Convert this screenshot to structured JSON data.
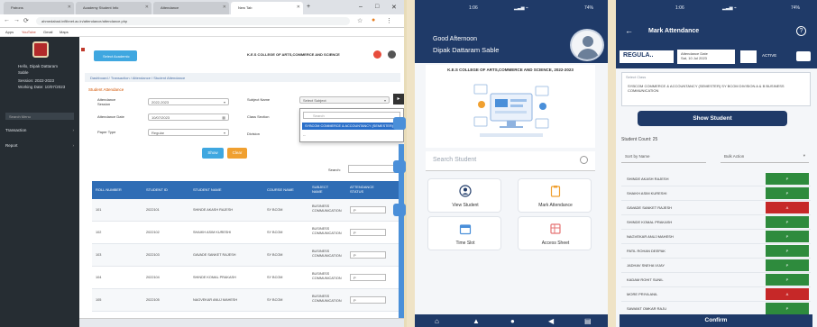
{
  "desktop": {
    "tabs": [
      {
        "label": "Patrons"
      },
      {
        "label": "Academy Student Info"
      },
      {
        "label": "Attendance"
      },
      {
        "label": "New Tab"
      }
    ],
    "url": "ahmedabad.inflibnet.ac.in/attendance/attendance.php",
    "bookmarks": [
      "Apps",
      "YouTube",
      "Gmail",
      "Maps"
    ],
    "sidebar": {
      "user_lines": [
        "Hello, Dipak Dattaram",
        "Sable",
        "Session: 2022-2023",
        "Working Date: 10/07/2023"
      ],
      "search_placeholder": "Search Menu",
      "items": [
        {
          "label": "Transaction"
        },
        {
          "label": "Report"
        }
      ]
    },
    "topbar": {
      "select_button": "Select Academic",
      "college": "K.E.S COLLEGE OF ARTS,COMMERCE AND SCIENCE"
    },
    "breadcrumb": "Dashboard / Transaction / Attendance / Student Attendance",
    "form": {
      "title": "Student Attendance",
      "fields": [
        {
          "label": "Attendance Session",
          "value": "2022-2023"
        },
        {
          "label": "Attendance Date",
          "value": "10/07/2023"
        },
        {
          "label": "Paper Type",
          "value": "Regular"
        },
        {
          "label": "Subject Name",
          "value": "Select Subject"
        },
        {
          "label": "Class Section",
          "value": ""
        },
        {
          "label": "Division",
          "value": "--"
        }
      ],
      "dropdown_search_placeholder": "Search",
      "dropdown_option": "SYBCOM COMMERCE & ACCOUNTANCY (SEMESTER)",
      "buttons": {
        "show": "Show",
        "clear": "Clear"
      },
      "search_label": "Search:"
    },
    "table": {
      "headers": [
        "ROLL NUMBER",
        "STUDENT ID",
        "STUDENT NAME",
        "COURSE NAME",
        "SUBJECT NAME",
        "ATTENDANCE STATUS"
      ],
      "rows": [
        {
          "roll": "101",
          "id": "2022101",
          "name": "SHINDE AKASH RAJESH",
          "course": "SY BCOM",
          "subject": "BUSINESS COMMUNICATION",
          "status": "P"
        },
        {
          "roll": "102",
          "id": "2022102",
          "name": "SHAIKH ASIM KURESHI",
          "course": "SY BCOM",
          "subject": "BUSINESS COMMUNICATION",
          "status": "P"
        },
        {
          "roll": "103",
          "id": "2022103",
          "name": "GAVADE SANKET RAJESH",
          "course": "SY BCOM",
          "subject": "BUSINESS COMMUNICATION",
          "status": "P"
        },
        {
          "roll": "104",
          "id": "2022104",
          "name": "SHINDE KOMAL PRAKASH",
          "course": "SY BCOM",
          "subject": "BUSINESS COMMUNICATION",
          "status": "P"
        },
        {
          "roll": "105",
          "id": "2022105",
          "name": "NAGVEKAR ANUJ MAHESH",
          "course": "SY BCOM",
          "subject": "BUSINESS COMMUNICATION",
          "status": "P"
        }
      ]
    }
  },
  "phone1": {
    "status": {
      "time": "1:06",
      "battery": "74%"
    },
    "greeting": "Good Afternoon",
    "user": "Dipak Dattaram Sable",
    "college": "K.E.S COLLEGE OF ARTS,COMMERCE AND SCIENCE, 2022-2023",
    "search_placeholder": "Search Student",
    "tiles": [
      {
        "label": "View Student",
        "icon": "user-circle-icon"
      },
      {
        "label": "Mark Attendance",
        "icon": "clipboard-icon"
      },
      {
        "label": "Time Slot",
        "icon": "calendar-icon"
      },
      {
        "label": "Access Sheet",
        "icon": "sheet-icon"
      }
    ],
    "bottom_nav": [
      "home-icon",
      "notification-icon",
      "profile-icon",
      "speaker-icon",
      "menu-icon"
    ]
  },
  "phone2": {
    "status": {
      "time": "1:06",
      "battery": "74%"
    },
    "title": "Mark Attendance",
    "paper_type": "REGULA..",
    "date": "Sat, 10 Jul 2023",
    "date_label": "Attendance Date",
    "out_time": "ACTIVE",
    "select_label": "Select Class",
    "select_value": "SYBCOM COMMERCE & ACCOUNTANCY (SEMESTER) SY BCOM DIVISION A & B BUSINESS COMMUNICATION",
    "show_button": "Show Student",
    "present_count": "Student Count: 25",
    "sort_placeholder": "Sort by Name",
    "bulk_action": "Bulk Action",
    "students": [
      {
        "name": "SHINDE AKASH RAJESH",
        "status": "P",
        "color": "#2e8b3d"
      },
      {
        "name": "SHAIKH ASIM KURESHI",
        "status": "P",
        "color": "#2e8b3d"
      },
      {
        "name": "GAVADE SANKET RAJESH",
        "status": "A",
        "color": "#c62828"
      },
      {
        "name": "SHINDE KOMAL PRAKASH",
        "status": "P",
        "color": "#2e8b3d"
      },
      {
        "name": "NAGVEKAR ANUJ MAHESH",
        "status": "P",
        "color": "#2e8b3d"
      },
      {
        "name": "PATIL ROHAN DEEPAK",
        "status": "P",
        "color": "#2e8b3d"
      },
      {
        "name": "JADHAV SNEHA VIJAY",
        "status": "P",
        "color": "#2e8b3d"
      },
      {
        "name": "KADAM ROHIT SUNIL",
        "status": "P",
        "color": "#2e8b3d"
      },
      {
        "name": "MORE PRIYA ANIL",
        "status": "A",
        "color": "#c62828"
      },
      {
        "name": "SAWANT OMKAR RAJU",
        "status": "P",
        "color": "#2e8b3d"
      }
    ],
    "confirm": "Confirm"
  }
}
